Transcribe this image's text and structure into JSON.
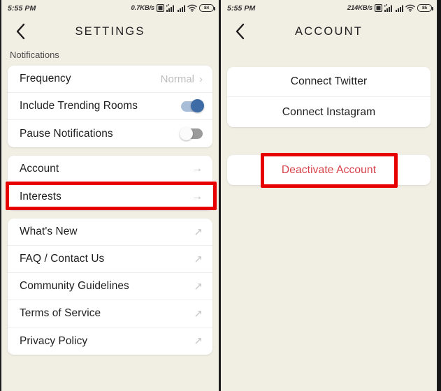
{
  "accent": {
    "annotation_red": "#e60000",
    "toggle_on": "#3d6ba5",
    "danger_text": "#d8404a"
  },
  "left_screen": {
    "status_bar": {
      "time": "5:55 PM",
      "network_speed": "0.7KB/s",
      "battery_level": "84",
      "icons": [
        "sim-card-icon",
        "signal-bars-icon",
        "signal-bars-icon",
        "wifi-icon",
        "battery-icon"
      ]
    },
    "app_bar": {
      "back_icon": "chevron-left-icon",
      "title": "SETTINGS"
    },
    "section_label": "Notifications",
    "notifications_card": [
      {
        "label": "Frequency",
        "value": "Normal",
        "control": "chevron"
      },
      {
        "label": "Include Trending Rooms",
        "control": "toggle",
        "state": "on"
      },
      {
        "label": "Pause Notifications",
        "control": "toggle",
        "state": "off"
      }
    ],
    "account_card": [
      {
        "label": "Account",
        "control": "arrow-right",
        "highlighted": true
      },
      {
        "label": "Interests",
        "control": "arrow-right",
        "highlighted": false
      }
    ],
    "links_card": [
      {
        "label": "What's New",
        "control": "arrow-up-right"
      },
      {
        "label": "FAQ / Contact Us",
        "control": "arrow-up-right"
      },
      {
        "label": "Community Guidelines",
        "control": "arrow-up-right"
      },
      {
        "label": "Terms of Service",
        "control": "arrow-up-right"
      },
      {
        "label": "Privacy Policy",
        "control": "arrow-up-right"
      }
    ]
  },
  "right_screen": {
    "status_bar": {
      "time": "5:55 PM",
      "network_speed": "214KB/s",
      "battery_level": "85",
      "icons": [
        "sim-card-icon",
        "signal-bars-icon",
        "signal-bars-icon",
        "wifi-icon",
        "battery-icon"
      ]
    },
    "app_bar": {
      "back_icon": "chevron-left-icon",
      "title": "ACCOUNT"
    },
    "connect_card": [
      {
        "label": "Connect Twitter"
      },
      {
        "label": "Connect Instagram"
      }
    ],
    "danger_card": [
      {
        "label": "Deactivate Account",
        "highlighted": true
      }
    ]
  }
}
